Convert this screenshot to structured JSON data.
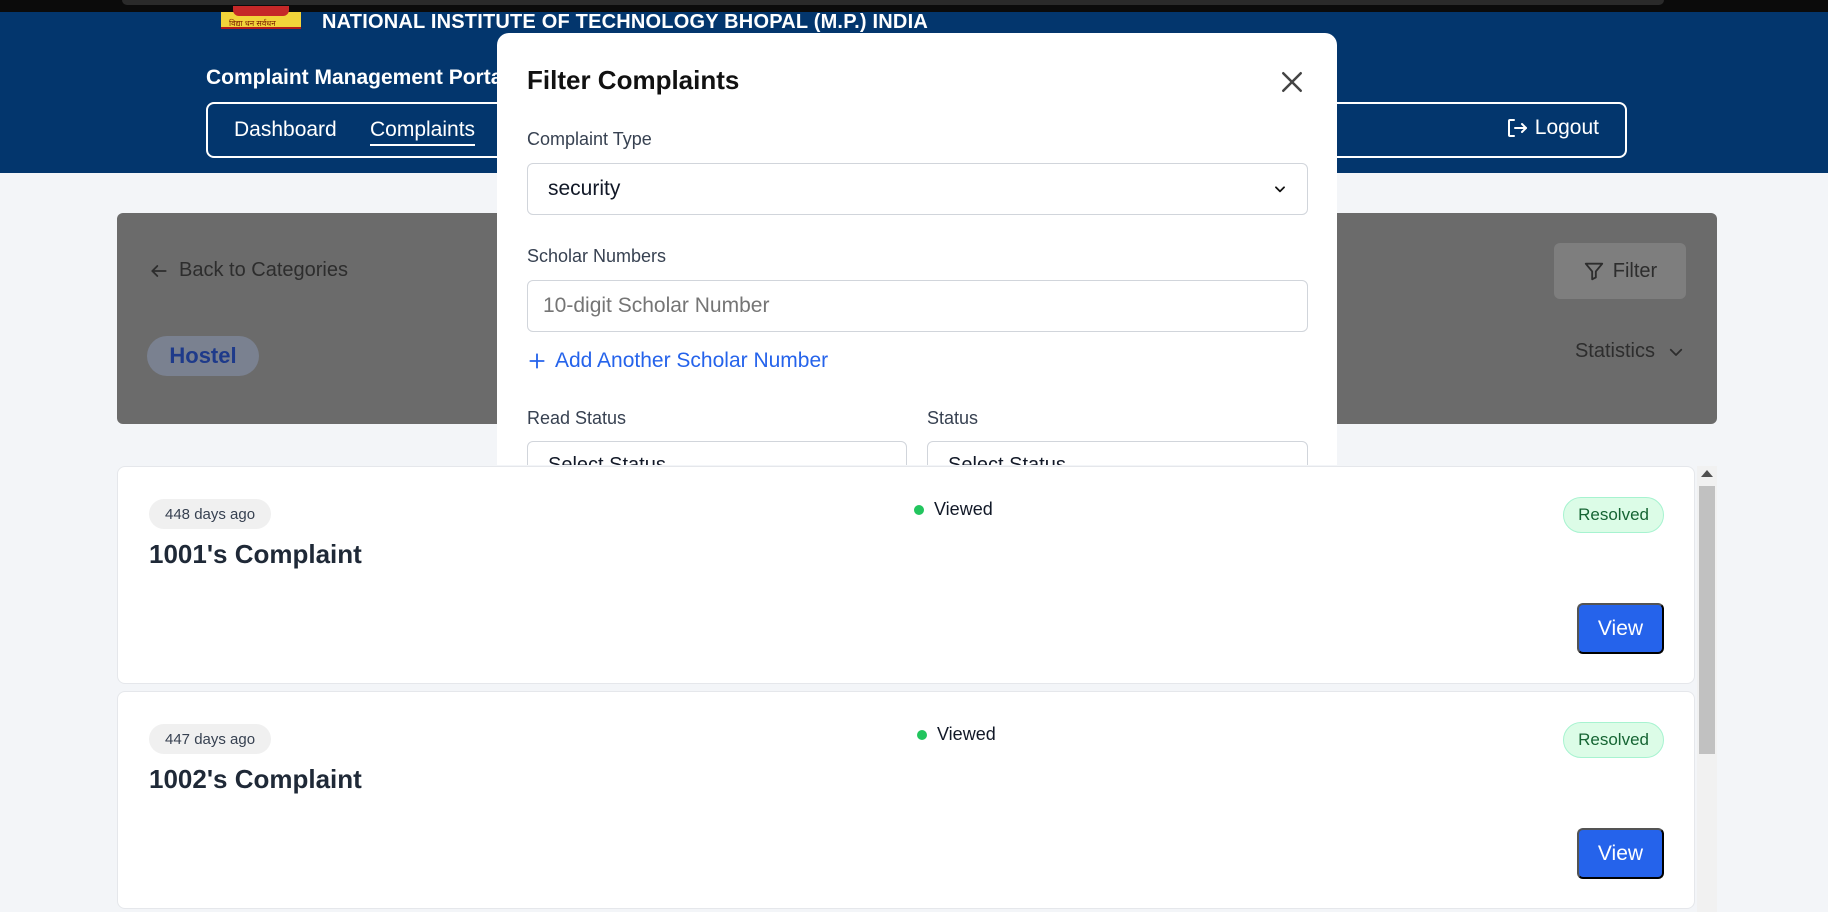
{
  "header": {
    "institute_name": "NATIONAL INSTITUTE OF TECHNOLOGY BHOPAL (M.P.) INDIA",
    "logo_text": "विद्या धन सर्वधन",
    "portal_title": "Complaint Management Portal",
    "nav": {
      "dashboard": "Dashboard",
      "complaints": "Complaints",
      "logout": "Logout"
    }
  },
  "category_panel": {
    "back_label": "Back to Categories",
    "filter_label": "Filter",
    "category": "Hostel",
    "statistics_label": "Statistics"
  },
  "complaints": [
    {
      "age": "448 days ago",
      "title": "1001's Complaint",
      "read_status": "Viewed",
      "status": "Resolved",
      "view_label": "View"
    },
    {
      "age": "447 days ago",
      "title": "1002's Complaint",
      "read_status": "Viewed",
      "status": "Resolved",
      "view_label": "View"
    }
  ],
  "filter_modal": {
    "title": "Filter Complaints",
    "complaint_type_label": "Complaint Type",
    "complaint_type_value": "security",
    "scholar_numbers_label": "Scholar Numbers",
    "scholar_placeholder": "10-digit Scholar Number",
    "add_scholar_label": "Add Another Scholar Number",
    "read_status_label": "Read Status",
    "read_status_value": "Select Status",
    "status_label": "Status",
    "status_value": "Select Status"
  },
  "colors": {
    "header_bg": "#03366d",
    "primary": "#2563eb",
    "resolved_bg": "#dcfce7",
    "resolved_text": "#166534",
    "viewed_dot": "#22c55e",
    "overlay": "#6b6b6b"
  },
  "icons": {
    "logout": "logout-icon",
    "back": "arrow-left-icon",
    "filter": "filter-funnel-icon",
    "statistics": "chevron-down-icon",
    "close": "close-icon",
    "select": "chevron-down-icon",
    "add": "plus-icon"
  }
}
